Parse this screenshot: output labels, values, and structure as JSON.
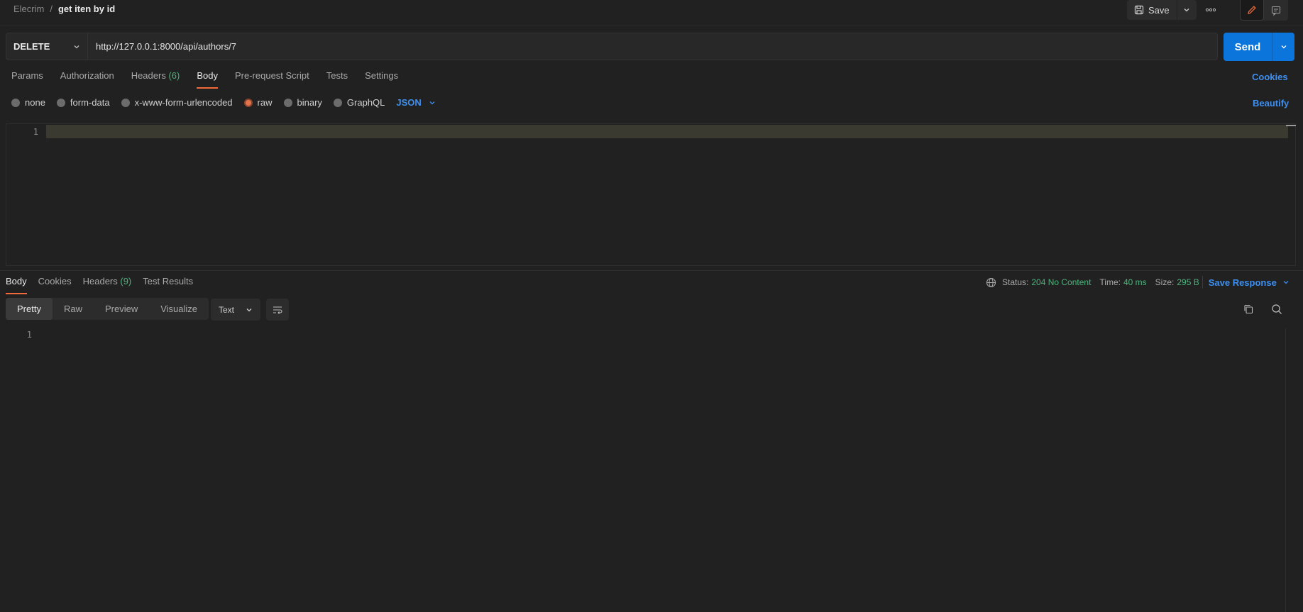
{
  "breadcrumb": {
    "workspace": "Elecrim",
    "separator": "/",
    "request_name": "get iten by id"
  },
  "toolbar": {
    "save_label": "Save"
  },
  "request": {
    "method": "DELETE",
    "url": "http://127.0.0.1:8000/api/authors/7",
    "send_label": "Send",
    "tabs": [
      {
        "label": "Params"
      },
      {
        "label": "Authorization"
      },
      {
        "label": "Headers",
        "count": "(6)"
      },
      {
        "label": "Body",
        "active": true
      },
      {
        "label": "Pre-request Script"
      },
      {
        "label": "Tests"
      },
      {
        "label": "Settings"
      }
    ],
    "cookies_label": "Cookies",
    "body_types": [
      {
        "label": "none"
      },
      {
        "label": "form-data"
      },
      {
        "label": "x-www-form-urlencoded"
      },
      {
        "label": "raw",
        "selected": true
      },
      {
        "label": "binary"
      },
      {
        "label": "GraphQL"
      }
    ],
    "body_format": "JSON",
    "beautify_label": "Beautify",
    "editor": {
      "line_number": "1"
    }
  },
  "response": {
    "tabs": [
      {
        "label": "Body",
        "active": true
      },
      {
        "label": "Cookies"
      },
      {
        "label": "Headers",
        "count": "(9)"
      },
      {
        "label": "Test Results"
      }
    ],
    "status_label": "Status:",
    "status_value": "204 No Content",
    "time_label": "Time:",
    "time_value": "40 ms",
    "size_label": "Size:",
    "size_value": "295 B",
    "save_response_label": "Save Response",
    "view_modes": [
      {
        "label": "Pretty",
        "active": true
      },
      {
        "label": "Raw"
      },
      {
        "label": "Preview"
      },
      {
        "label": "Visualize"
      }
    ],
    "language": "Text",
    "editor": {
      "line_number": "1"
    }
  },
  "colors": {
    "background": "#212121",
    "accent_blue": "#0c75dc",
    "link_blue": "#3d8ff0",
    "active_tab_orange": "#f26b3a",
    "success_green": "#4cb27c"
  }
}
